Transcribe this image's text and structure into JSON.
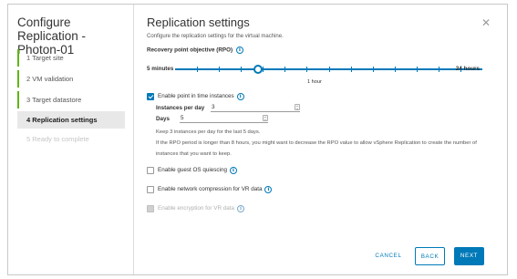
{
  "wizard": {
    "title": "Configure Replication - Photon-01",
    "steps": [
      {
        "label": "1  Target site"
      },
      {
        "label": "2  VM validation"
      },
      {
        "label": "3  Target datastore"
      },
      {
        "label": "4  Replication settings"
      },
      {
        "label": "5  Ready to complete"
      }
    ]
  },
  "main": {
    "title": "Replication settings",
    "subtitle": "Configure the replication settings for the virtual machine.",
    "rpo": {
      "label": "Recovery point objective (RPO)",
      "min_label": "5 minutes",
      "max_label": "24 hours",
      "value_label": "1 hour",
      "value_fraction": 0.27
    },
    "pit": {
      "label": "Enable point in time instances",
      "checked": true,
      "instances_label": "Instances per day",
      "instances_value": "3",
      "days_label": "Days",
      "days_value": "5",
      "helper": "Keep 3 instances per day for the last 5 days.",
      "warning": "If the RPO period is longer than 8 hours, you might want to decrease the RPO value to allow vSphere Replication to create the number of instances that you want to keep."
    },
    "quiescing_label": "Enable guest OS quiescing",
    "compression_label": "Enable network compression for VR data",
    "encryption_label": "Enable encryption for VR data"
  },
  "footer": {
    "cancel": "CANCEL",
    "back": "BACK",
    "next": "NEXT"
  },
  "colors": {
    "accent": "#0079b8",
    "complete": "#60b515"
  },
  "icons": {
    "info": "info-circle-icon",
    "close": "close-icon",
    "check": "checkmark-icon"
  }
}
